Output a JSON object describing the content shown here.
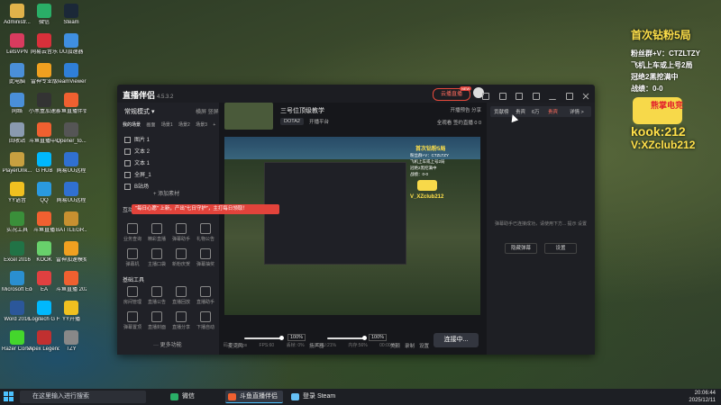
{
  "desktop": {
    "icons": [
      {
        "label": "Administr...",
        "color": "#e0b24a"
      },
      {
        "label": "微信",
        "color": "#2aae67"
      },
      {
        "label": "Steam",
        "color": "#1b2838"
      },
      {
        "label": "LetsVPN",
        "color": "#d83b5e"
      },
      {
        "label": "网易云音乐",
        "color": "#d8303a"
      },
      {
        "label": "UU加速器",
        "color": "#3f8fe0"
      },
      {
        "label": "此电脑",
        "color": "#4a8fd8"
      },
      {
        "label": "雷神专业版",
        "color": "#f0a020"
      },
      {
        "label": "TeamViewer",
        "color": "#2f7fd8"
      },
      {
        "label": "网络",
        "color": "#4a8fd8"
      },
      {
        "label": "小黑盒加速器",
        "color": "#333333"
      },
      {
        "label": "斗鱼直播伴侣",
        "color": "#f06030"
      },
      {
        "label": "回收站",
        "color": "#8a9ab0"
      },
      {
        "label": "斗鱼直播中心",
        "color": "#f06030"
      },
      {
        "label": "Opener_to...",
        "color": "#555555"
      },
      {
        "label": "PlayerUnk...",
        "color": "#c8a040"
      },
      {
        "label": "G HUB",
        "color": "#00b8fc"
      },
      {
        "label": "网易UU远程",
        "color": "#3070d0"
      },
      {
        "label": "YY语音",
        "color": "#f0c020"
      },
      {
        "label": "QQ",
        "color": "#2a9ae0"
      },
      {
        "label": "网易UU远程",
        "color": "#3070d0"
      },
      {
        "label": "实况工具",
        "color": "#3a8f3a"
      },
      {
        "label": "斗鱼直播",
        "color": "#f06030"
      },
      {
        "label": "BATTLEGR...",
        "color": "#c89030"
      },
      {
        "label": "Excel 2016",
        "color": "#217346"
      },
      {
        "label": "KOOK",
        "color": "#68d06b"
      },
      {
        "label": "雷神加速模拟器",
        "color": "#f0a020"
      },
      {
        "label": "Microsoft Edge",
        "color": "#2a8fd0"
      },
      {
        "label": "EA",
        "color": "#e04040"
      },
      {
        "label": "斗鱼直播 2025080...",
        "color": "#f06030"
      },
      {
        "label": "Word 2016",
        "color": "#2b579a"
      },
      {
        "label": "Logitech G HUB",
        "color": "#00b8fc"
      },
      {
        "label": "YY开播",
        "color": "#f0c020"
      },
      {
        "label": "Razer Cortex",
        "color": "#44d62c"
      },
      {
        "label": "Apex Legends",
        "color": "#c03030"
      },
      {
        "label": "TZY",
        "color": "#888888"
      }
    ]
  },
  "overlay": {
    "title": "首次钻粉5局",
    "line1": "粉丝群+V：CTZLTZY",
    "line2": "飞机上车或上号2局",
    "line3": "冠绝2黑挖满中",
    "line4": "战绩：0-0",
    "logo_text": "熊掌电竞",
    "kook": "kook:212",
    "vx": "V:XZclub212"
  },
  "app": {
    "logo": "直播伴侣",
    "version": "4.5.3.2",
    "open_live": "云播直播",
    "new_badge": "NEW",
    "left": {
      "mode": "常规模式 ▾",
      "mode_right": "横屏  竖屏",
      "tabs": [
        "我的场景",
        "画面",
        "场景1",
        "场景2",
        "场景3",
        "+"
      ],
      "scenes": [
        "图片 1",
        "文本 2",
        "文本 1",
        "全屏_1",
        "B站场"
      ],
      "add_source": "+ 添加素材",
      "section1": "互动",
      "tools1": [
        "业务查询",
        "精彩直播",
        "弹幕助手",
        "礼物公告",
        "弹幕机",
        "主播口袋",
        "新粉庆贺",
        "弹幕抽奖"
      ],
      "section2": "基础工具",
      "tools2": [
        "房间管理",
        "直播公告",
        "直播回放",
        "直播助手",
        "弹幕置顶",
        "直播封面",
        "直播分享",
        "下播自动"
      ],
      "more": "··· 更多功能",
      "toast": "\"每日心愿\" 上新，产出\"七日守护\"，主打每日领取！"
    },
    "center": {
      "game_title": "三号位顶级教学",
      "category": "DOTA2",
      "category2": "开播平台",
      "top_ctrls": "开播预告   分享",
      "ctrls2": "全观看   签约直播   0   0",
      "preview_title": "首次钻粉5局",
      "preview_sub": [
        "粉丝群+V：CTZLTZY",
        "飞机上车或上号2局",
        "冠绝2黑挖满中",
        "战绩：0-0"
      ],
      "preview_kook": "V_XZclub212",
      "mic_label": "麦克风",
      "mic_pct": "100%",
      "speaker_label": "扬声器",
      "speaker_pct": "100%",
      "tool_labels": [
        "美颜",
        "录制",
        "设置"
      ],
      "connect": "连接中...",
      "status": [
        "码率: 0kbps",
        "FPS:60",
        "丢帧: 0%",
        "CPU:21%",
        "内存:56%",
        "00:00:00"
      ]
    },
    "right": {
      "tabs": [
        "贡献榜",
        "贵宾",
        "6万",
        "贵宾",
        "详情 >"
      ],
      "tip": "弹幕助手已连接成功，请使用下方... 提示 设置",
      "btn1": "隐藏弹幕",
      "btn2": "设置"
    }
  },
  "taskbar": {
    "search_placeholder": "在这里输入进行搜索",
    "apps": [
      "微信",
      "斗鱼直播伴侣",
      "登录 Steam"
    ],
    "time": "20:06:44",
    "date": "2025/12/11"
  },
  "colors": {
    "accent": "#e2433b",
    "yellow": "#ffe04a",
    "taskbar_blue": "#4cc2ff"
  }
}
